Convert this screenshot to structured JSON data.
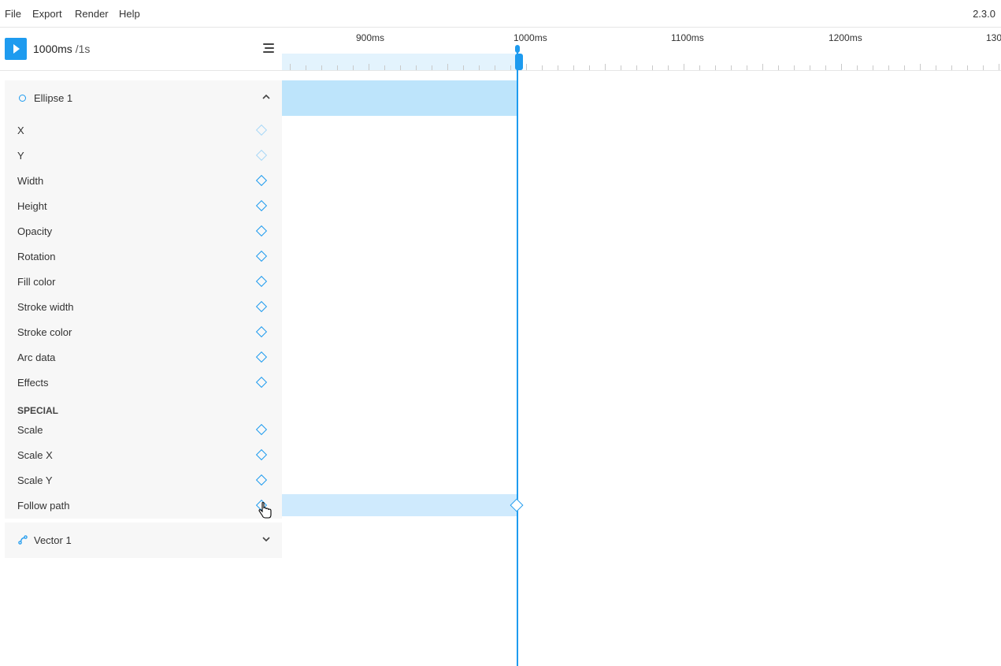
{
  "menubar": {
    "items": [
      "File",
      "Export",
      "Render",
      "Help"
    ],
    "version": "2.3.0"
  },
  "toolbar": {
    "current_time": "1000ms",
    "separator": " /",
    "total_time": "1s"
  },
  "ruler": {
    "labels": [
      "900ms",
      "1000ms",
      "1100ms",
      "1200ms",
      "130"
    ]
  },
  "layers": [
    {
      "name": "Ellipse 1",
      "icon": "ellipse-icon",
      "expanded": true,
      "properties": [
        "X",
        "Y",
        "Width",
        "Height",
        "Opacity",
        "Rotation",
        "Fill color",
        "Stroke width",
        "Stroke color",
        "Arc data",
        "Effects"
      ],
      "special_heading": "SPECIAL",
      "special_properties": [
        "Scale",
        "Scale X",
        "Scale Y",
        "Follow path"
      ]
    },
    {
      "name": "Vector 1",
      "icon": "vector-path-icon",
      "expanded": false
    }
  ],
  "colors": {
    "accent": "#1e9bef",
    "track_fill": "#bde4fb",
    "panel_bg": "#f7f7f7"
  }
}
